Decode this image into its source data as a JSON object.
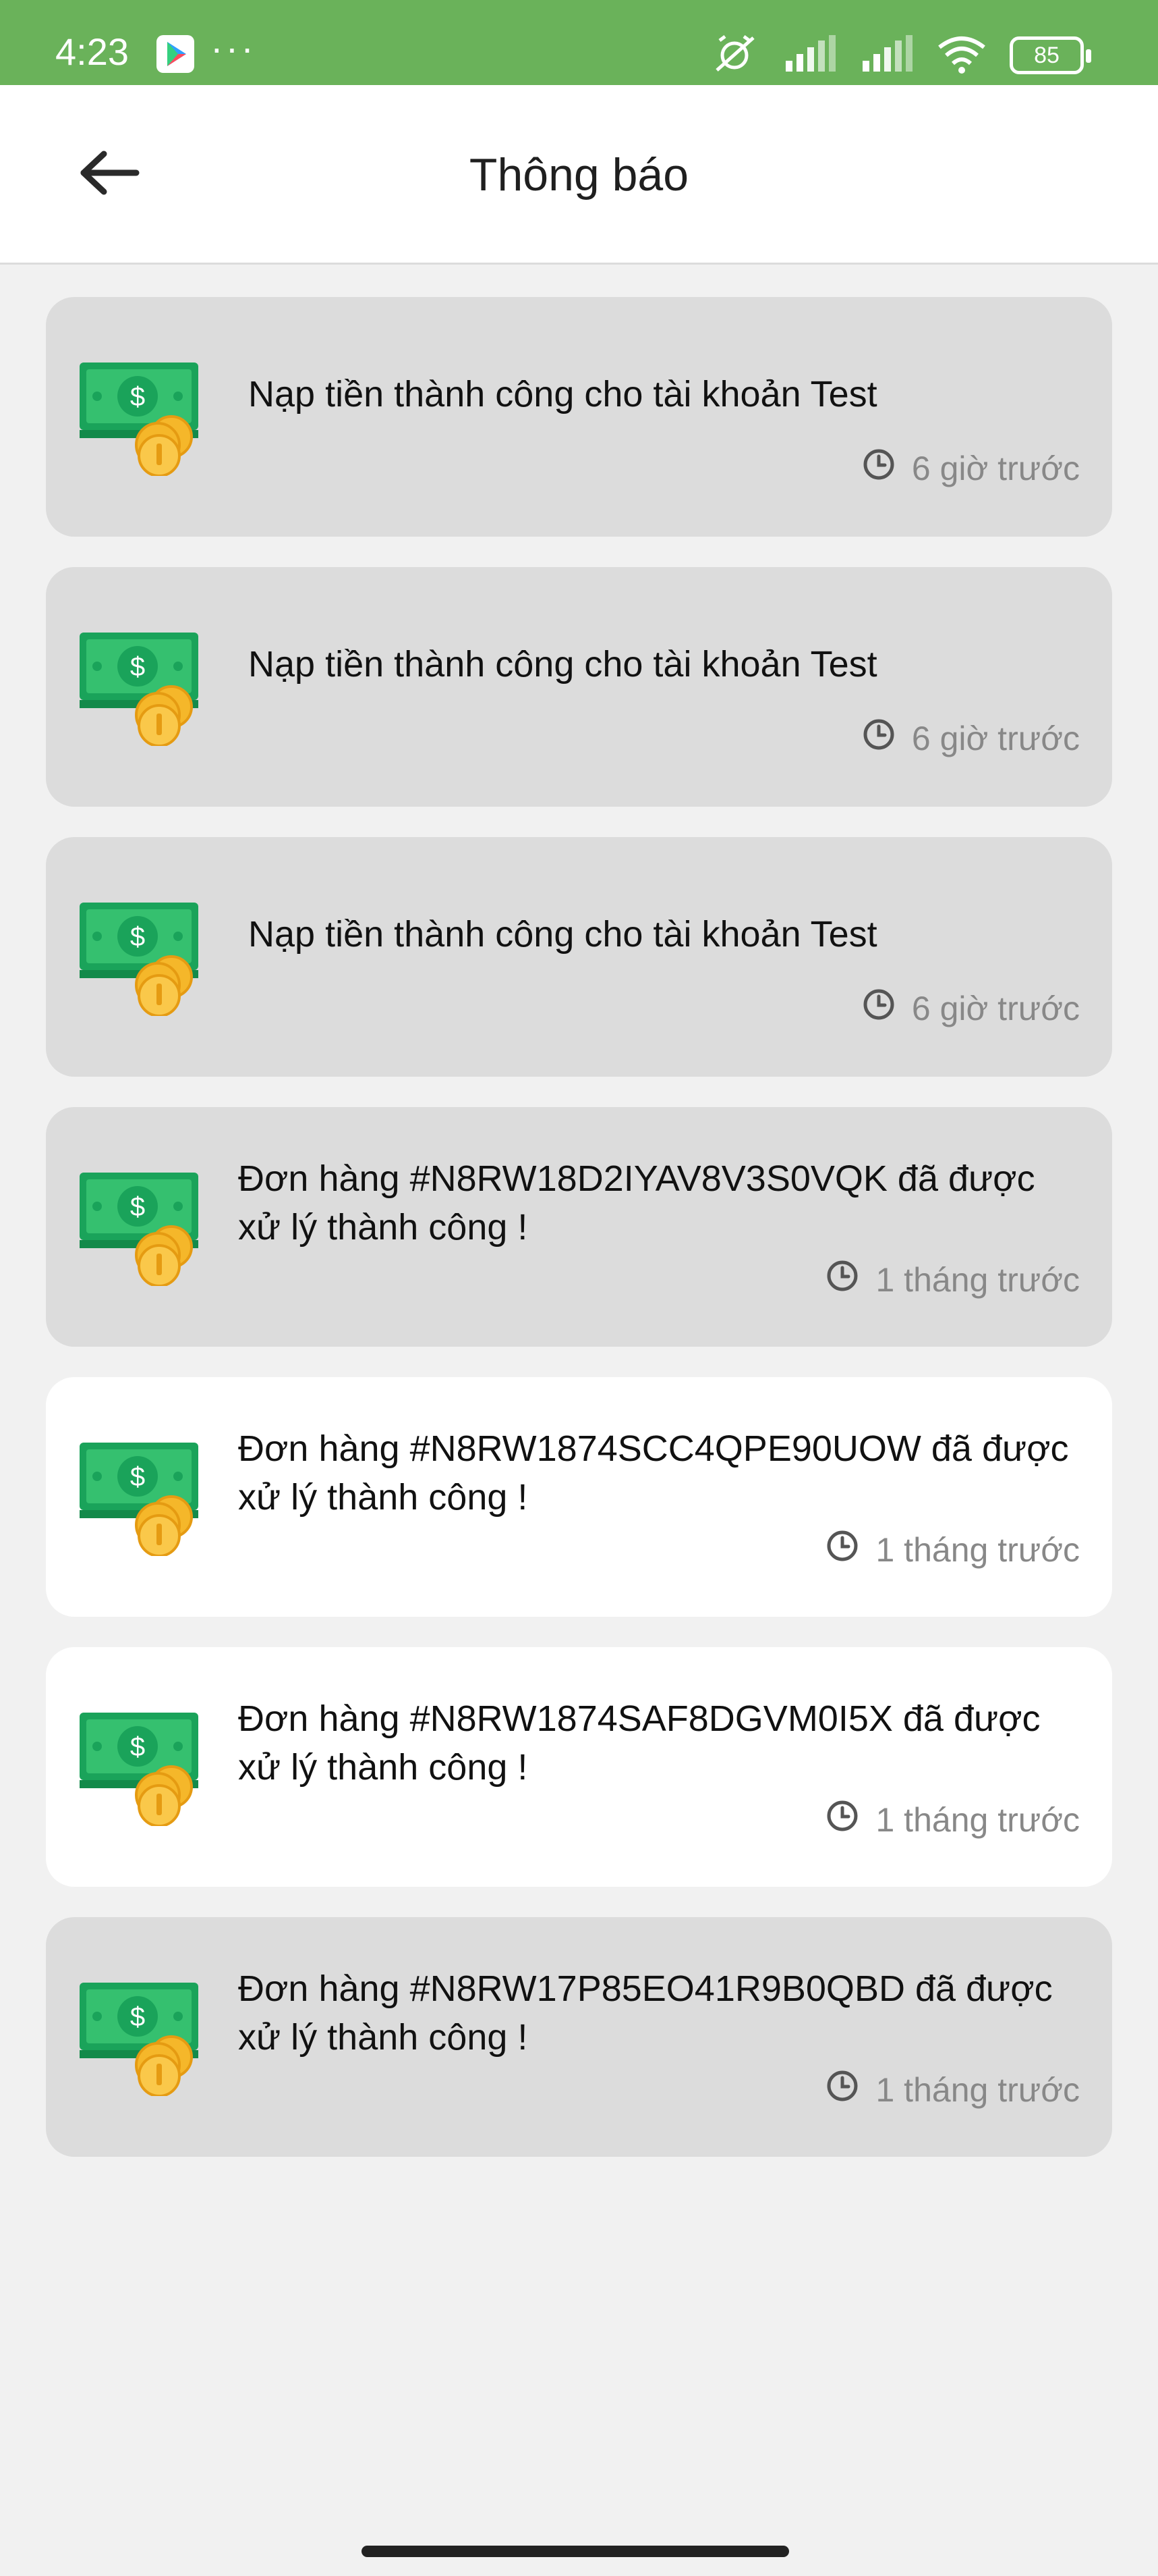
{
  "statusbar": {
    "time": "4:23",
    "dots": "···",
    "battery": "85"
  },
  "header": {
    "title": "Thông báo"
  },
  "notifications": [
    {
      "text": "Nạp tiền thành công cho tài khoản Test",
      "time": "6 giờ trước",
      "read": true
    },
    {
      "text": "Nạp tiền thành công cho tài khoản Test",
      "time": "6 giờ trước",
      "read": true
    },
    {
      "text": "Nạp tiền thành công cho tài khoản Test",
      "time": "6 giờ trước",
      "read": true
    },
    {
      "text": "Đơn hàng #N8RW18D2IYAV8V3S0VQK đã được xử lý thành công !",
      "time": "1 tháng trước",
      "read": true
    },
    {
      "text": "Đơn hàng #N8RW1874SCC4QPE90UOW đã được xử lý thành công !",
      "time": "1 tháng trước",
      "read": false
    },
    {
      "text": "Đơn hàng #N8RW1874SAF8DGVM0I5X đã được xử lý thành công !",
      "time": "1 tháng trước",
      "read": false
    },
    {
      "text": "Đơn hàng #N8RW17P85EO41R9B0QBD đã được xử lý thành công !",
      "time": "1 tháng trước",
      "read": true
    }
  ],
  "colors": {
    "statusbar": "#6ab25a",
    "card_read": "#dcdcdc",
    "card_unread": "#ffffff",
    "money_green": "#1aa35a",
    "coin_gold": "#f5b72a"
  },
  "icons": {
    "back": "arrow-left-icon",
    "notification": "money-icon",
    "time": "clock-icon"
  }
}
